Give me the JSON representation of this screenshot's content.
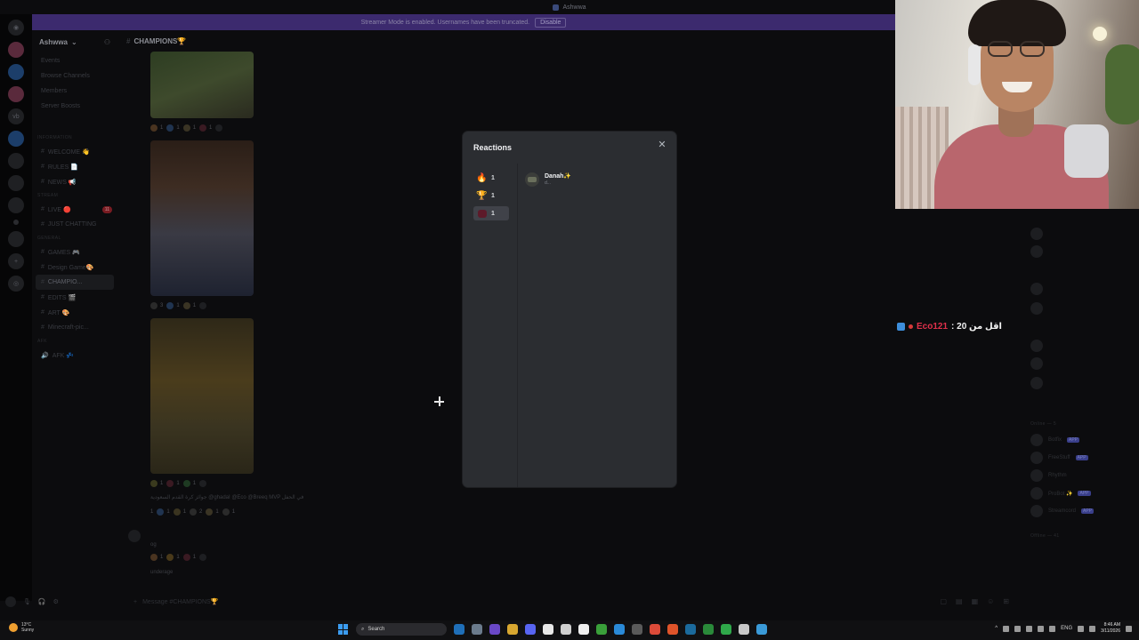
{
  "window": {
    "title": "Ashwwa"
  },
  "banner": {
    "text": "Streamer Mode is enabled. Usernames have been truncated.",
    "disable_label": "Disable"
  },
  "server": {
    "name": "Ashwwa"
  },
  "sidebar": {
    "top_items": [
      "Events",
      "Browse Channels",
      "Members",
      "Server Boosts"
    ],
    "categories": [
      {
        "label": "INFORMATION",
        "channels": [
          "WELCOME 👋",
          "RULES 📄",
          "NEWS 📢"
        ]
      },
      {
        "label": "STREAM",
        "channels": [
          "LIVE 🔴",
          "JUST CHATTING"
        ]
      },
      {
        "label": "GENERAL",
        "channels": [
          "GAMES 🎮",
          "Design Game🎨",
          "CHAMPIO...",
          "EDITS 🎬",
          "ART 🎨",
          "Minecraft-pic..."
        ]
      },
      {
        "label": "AFK",
        "channels": [
          "AFK 💤"
        ]
      }
    ],
    "live_badge": "11"
  },
  "channel": {
    "name": "CHAMPIONS🏆"
  },
  "messages": {
    "reactions_1": [
      "1",
      "1",
      "1",
      "1"
    ],
    "reactions_2": [
      "3",
      "1",
      "1"
    ],
    "reactions_3": [
      "1",
      "1",
      "1"
    ],
    "caption": "جوائز كرة القدم السعودية  @ghadaI  @Eco  @Breeq  MVP في الحفل",
    "reactions_4": [
      "1",
      "1",
      "1",
      "2",
      "1",
      "1"
    ],
    "reply_text": "og",
    "reactions_5": [
      "1",
      "1",
      "1"
    ],
    "last_text": "underage"
  },
  "composer": {
    "placeholder": "Message #CHAMPIONS🏆"
  },
  "modal": {
    "title": "Reactions",
    "tabs": [
      {
        "emoji": "🔥",
        "count": "1"
      },
      {
        "emoji": "🏆",
        "count": "1"
      },
      {
        "emoji": "heart",
        "count": "1"
      }
    ],
    "users": [
      {
        "name": "Danah✨",
        "sub": "d..."
      }
    ]
  },
  "stream_chat": {
    "username": "Eco121",
    "text": ": اقل من 20"
  },
  "members": {
    "online_label": "Online — 5",
    "offline_label": "Offline — 41",
    "apps": [
      {
        "name": "Botfix",
        "tag": "APP"
      },
      {
        "name": "FreeStuff",
        "tag": "APP"
      },
      {
        "name": "Rhythm",
        "tag": ""
      },
      {
        "name": "ProBot ✨",
        "tag": "APP"
      },
      {
        "name": "Streamcord",
        "tag": "APP"
      }
    ]
  },
  "taskbar": {
    "weather_temp": "13°C",
    "weather_desc": "Sunny",
    "search_label": "Search",
    "lang": "ENG",
    "time": "8:46 AM",
    "date": "3/11/2026"
  },
  "colors": {
    "modal_bg": "#2b2d31",
    "accent": "#5865f2",
    "banner": "#3c2a6e"
  }
}
